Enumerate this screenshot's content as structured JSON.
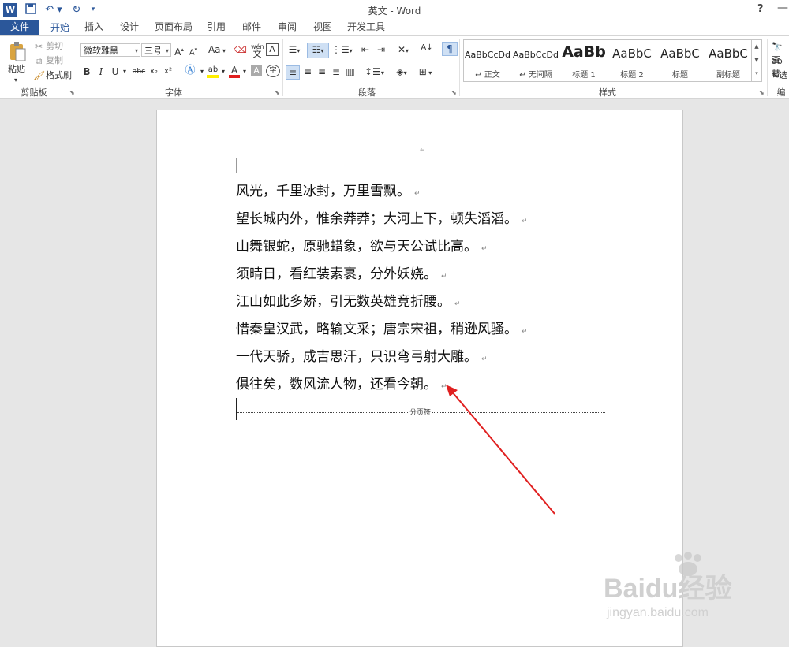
{
  "app": {
    "title": "英文 - Word",
    "help": "?",
    "minimize": "—"
  },
  "tabs": [
    "文件",
    "开始",
    "插入",
    "设计",
    "页面布局",
    "引用",
    "邮件",
    "审阅",
    "视图",
    "开发工具"
  ],
  "ribbon": {
    "clipboard": {
      "label": "剪贴板",
      "paste": "粘贴",
      "cut": "剪切",
      "copy": "复制",
      "format_painter": "格式刷"
    },
    "font": {
      "label": "字体",
      "name": "微软雅黑",
      "size": "三号",
      "aa": "Aa",
      "wen": "wén",
      "wen_char": "文",
      "bold": "B",
      "italic": "I",
      "underline": "U",
      "strike": "abc",
      "subscript": "x₂",
      "superscript": "x²",
      "font_color": "A",
      "highlight": "ab",
      "char_shade": "A",
      "enclose": "字"
    },
    "paragraph": {
      "label": "段落"
    },
    "styles": {
      "label": "样式",
      "items": [
        {
          "sample": "AaBbCcDd",
          "name": "↵ 正文"
        },
        {
          "sample": "AaBbCcDd",
          "name": "↵ 无间隔"
        },
        {
          "sample": "AaBb",
          "name": "标题 1"
        },
        {
          "sample": "AaBbC",
          "name": "标题 2"
        },
        {
          "sample": "AaBbC",
          "name": "标题"
        },
        {
          "sample": "AaBbC",
          "name": "副标题"
        }
      ]
    },
    "editing": {
      "find": "查",
      "replace": "替",
      "select": "选",
      "label": "编"
    }
  },
  "document": {
    "top_mark": "↵",
    "lines": [
      "风光，千里冰封，万里雪飘。",
      "望长城内外，惟余莽莽；大河上下，顿失滔滔。",
      "山舞银蛇，原驰蜡象，欲与天公试比高。",
      "须晴日，看红装素裹，分外妖娆。",
      "江山如此多娇，引无数英雄竞折腰。",
      "惜秦皇汉武，略输文采；唐宗宋祖，稍逊风骚。",
      "一代天骄，成吉思汗，只识弯弓射大雕。",
      "俱往矣，数风流人物，还看今朝。"
    ],
    "paragraph_mark": "↵",
    "page_break_label": "分页符"
  },
  "watermark": {
    "brand": "Baidu经验",
    "url": "jingyan.baidu.com"
  },
  "colors": {
    "accent": "#2b579a",
    "arrow": "#e02020"
  }
}
